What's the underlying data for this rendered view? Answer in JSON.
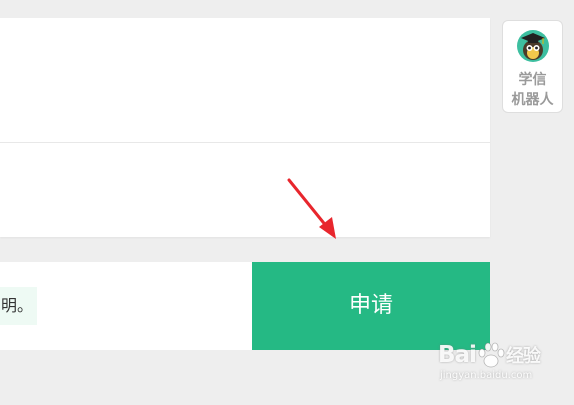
{
  "form": {
    "notice_text": "明。"
  },
  "actions": {
    "apply_label": "申请",
    "apply_color": "#25b984"
  },
  "robot_widget": {
    "line1": "学信",
    "line2": "机器人",
    "avatar_icon": "graduate-owl-icon"
  },
  "annotation": {
    "arrow_color": "#e8262d",
    "arrow_icon": "red-arrow-icon"
  },
  "watermark": {
    "brand": "Bai",
    "brand_suffix": "经验",
    "url": "jingyan.baidu.com"
  }
}
